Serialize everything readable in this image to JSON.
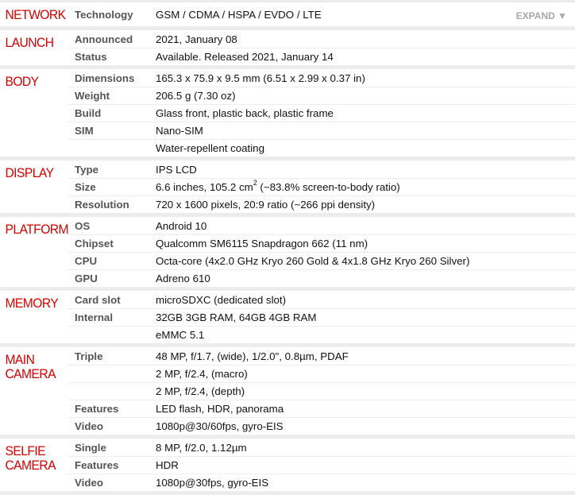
{
  "sections": [
    {
      "title": "NETWORK",
      "rows": [
        {
          "label": "Technology",
          "value": "GSM / CDMA / HSPA / EVDO / LTE"
        }
      ],
      "expand_label": "EXPAND ▼"
    },
    {
      "title": "LAUNCH",
      "rows": [
        {
          "label": "Announced",
          "value": "2021, January 08"
        },
        {
          "label": "Status",
          "value": "Available. Released 2021, January 14"
        }
      ]
    },
    {
      "title": "BODY",
      "rows": [
        {
          "label": "Dimensions",
          "value": "165.3 x 75.9 x 9.5 mm (6.51 x 2.99 x 0.37 in)"
        },
        {
          "label": "Weight",
          "value": "206.5 g (7.30 oz)"
        },
        {
          "label": "Build",
          "value": "Glass front, plastic back, plastic frame"
        },
        {
          "label": "SIM",
          "value": "Nano-SIM"
        },
        {
          "label": "",
          "value": "Water-repellent coating"
        }
      ]
    },
    {
      "title": "DISPLAY",
      "rows": [
        {
          "label": "Type",
          "value": "IPS LCD"
        },
        {
          "label": "Size",
          "value": "6.6 inches, 105.2 cm",
          "sup": "2",
          "value_after": " (~83.8% screen-to-body ratio)"
        },
        {
          "label": "Resolution",
          "value": "720 x 1600 pixels, 20:9 ratio (~266 ppi density)"
        }
      ]
    },
    {
      "title": "PLATFORM",
      "rows": [
        {
          "label": "OS",
          "value": "Android 10"
        },
        {
          "label": "Chipset",
          "value": "Qualcomm SM6115 Snapdragon 662 (11 nm)"
        },
        {
          "label": "CPU",
          "value": "Octa-core (4x2.0 GHz Kryo 260 Gold & 4x1.8 GHz Kryo 260 Silver)"
        },
        {
          "label": "GPU",
          "value": "Adreno 610"
        }
      ]
    },
    {
      "title": "MEMORY",
      "rows": [
        {
          "label": "Card slot",
          "value": "microSDXC (dedicated slot)"
        },
        {
          "label": "Internal",
          "value": "32GB 3GB RAM, 64GB 4GB RAM"
        },
        {
          "label": "",
          "value": "eMMC 5.1"
        }
      ]
    },
    {
      "title": "MAIN CAMERA",
      "title_lines": [
        "MAIN",
        "CAMERA"
      ],
      "rows": [
        {
          "label": "Triple",
          "value": "48 MP, f/1.7, (wide), 1/2.0\", 0.8µm, PDAF"
        },
        {
          "label": "",
          "value": "2 MP, f/2.4, (macro)"
        },
        {
          "label": "",
          "value": "2 MP, f/2.4, (depth)"
        },
        {
          "label": "Features",
          "value": "LED flash, HDR, panorama"
        },
        {
          "label": "Video",
          "value": "1080p@30/60fps, gyro-EIS"
        }
      ]
    },
    {
      "title": "SELFIE CAMERA",
      "title_lines": [
        "SELFIE",
        "CAMERA"
      ],
      "rows": [
        {
          "label": "Single",
          "value": "8 MP, f/2.0, 1.12µm"
        },
        {
          "label": "Features",
          "value": "HDR"
        },
        {
          "label": "Video",
          "value": "1080p@30fps, gyro-EIS"
        }
      ]
    }
  ]
}
